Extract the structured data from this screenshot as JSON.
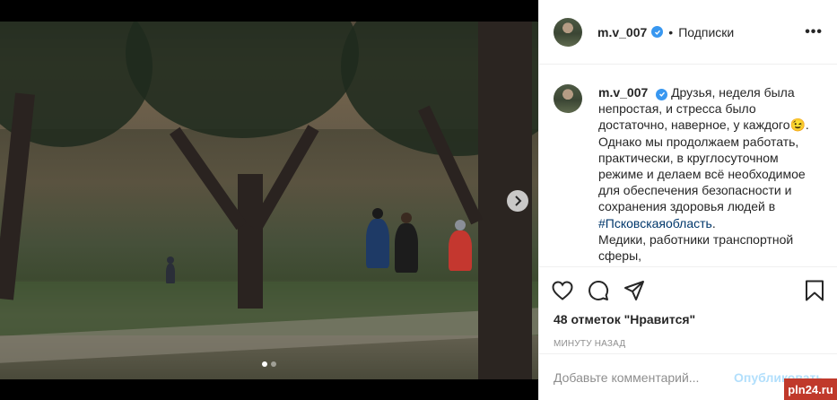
{
  "post": {
    "username": "m.v_007",
    "follow_label": "Подписки",
    "more_label": "•••",
    "caption_text": "Друзья, неделя была непростая, и стресса было достаточно, наверное, у каждого😉. Однако мы продолжаем работать, практически, в круглосуточном режиме и делаем всё необходимое для обеспечения безопасности и сохранения здоровья людей в ",
    "hashtag": "#Псковскаяобласть",
    "caption_text_2": "Медики, работники транспортной сферы,",
    "likes": "48 отметок \"Нравится\"",
    "time": "МИНУТУ НАЗАД",
    "comment_placeholder": "Добавьте комментарий...",
    "publish_label": "Опубликовать"
  },
  "carousel": {
    "slides": 2,
    "active_slide": 1
  },
  "watermark": "pln24.ru",
  "icons": {
    "verified": "verified-badge-icon",
    "like": "heart-icon",
    "comment": "comment-icon",
    "share": "share-icon",
    "save": "bookmark-icon",
    "next": "chevron-right-icon"
  },
  "colors": {
    "verified": "#3897f0",
    "publish_disabled": "#b2dffc",
    "hashtag": "#00376b",
    "watermark_bg": "#c0392b"
  }
}
